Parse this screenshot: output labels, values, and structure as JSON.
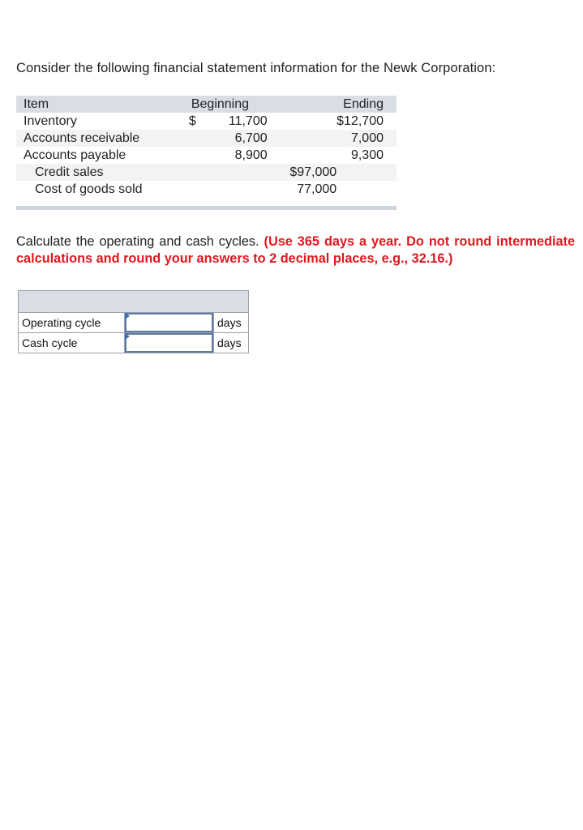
{
  "intro": "Consider the following financial statement information for the Newk Corporation:",
  "fin_table": {
    "headers": [
      "Item",
      "Beginning",
      "",
      "Ending"
    ],
    "rows": [
      {
        "item": "Inventory",
        "beginning_currency": "$",
        "beginning": "11,700",
        "middle": "",
        "ending": "$12,700"
      },
      {
        "item": "Accounts receivable",
        "beginning_currency": "",
        "beginning": "6,700",
        "middle": "",
        "ending": "7,000"
      },
      {
        "item": "Accounts payable",
        "beginning_currency": "",
        "beginning": "8,900",
        "middle": "",
        "ending": "9,300"
      },
      {
        "item": "Credit sales",
        "beginning_currency": "",
        "beginning": "",
        "middle": "$97,000",
        "ending": ""
      },
      {
        "item": "Cost of goods sold",
        "beginning_currency": "",
        "beginning": "",
        "middle": "77,000",
        "ending": ""
      }
    ]
  },
  "instructions": {
    "plain": "Calculate the operating and cash cycles. ",
    "emphasis": "(Use 365 days a year. Do not round intermediate calculations and round your answers to 2 decimal places, e.g., 32.16.)"
  },
  "answer_table": {
    "rows": [
      {
        "label": "Operating cycle",
        "value": "",
        "unit": "days"
      },
      {
        "label": "Cash cycle",
        "value": "",
        "unit": "days"
      }
    ]
  }
}
